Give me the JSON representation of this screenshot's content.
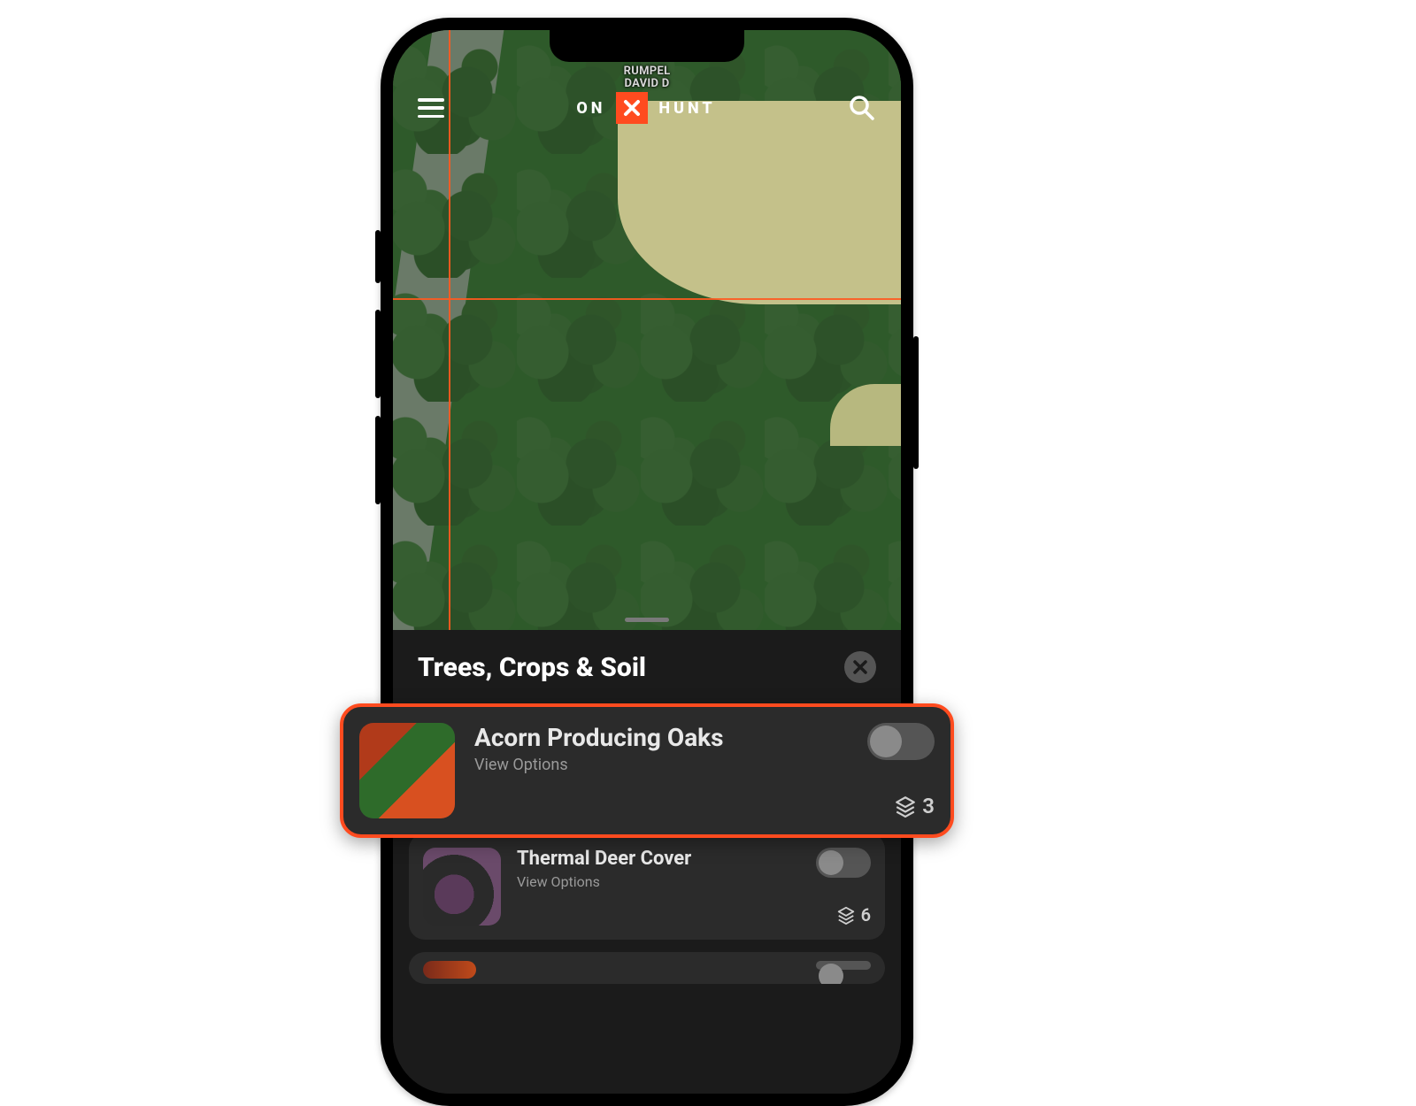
{
  "header": {
    "brand_left": "ON",
    "brand_right": "HUNT",
    "owner_line1": "RUMPEL",
    "owner_line2": "DAVID D"
  },
  "panel": {
    "title": "Trees, Crops & Soil",
    "items": [
      {
        "title": "Acorn Producing Oaks",
        "sub": "View Options",
        "count": "3"
      },
      {
        "title": "Thermal Deer Cover",
        "sub": "View Options",
        "count": "6"
      }
    ]
  }
}
